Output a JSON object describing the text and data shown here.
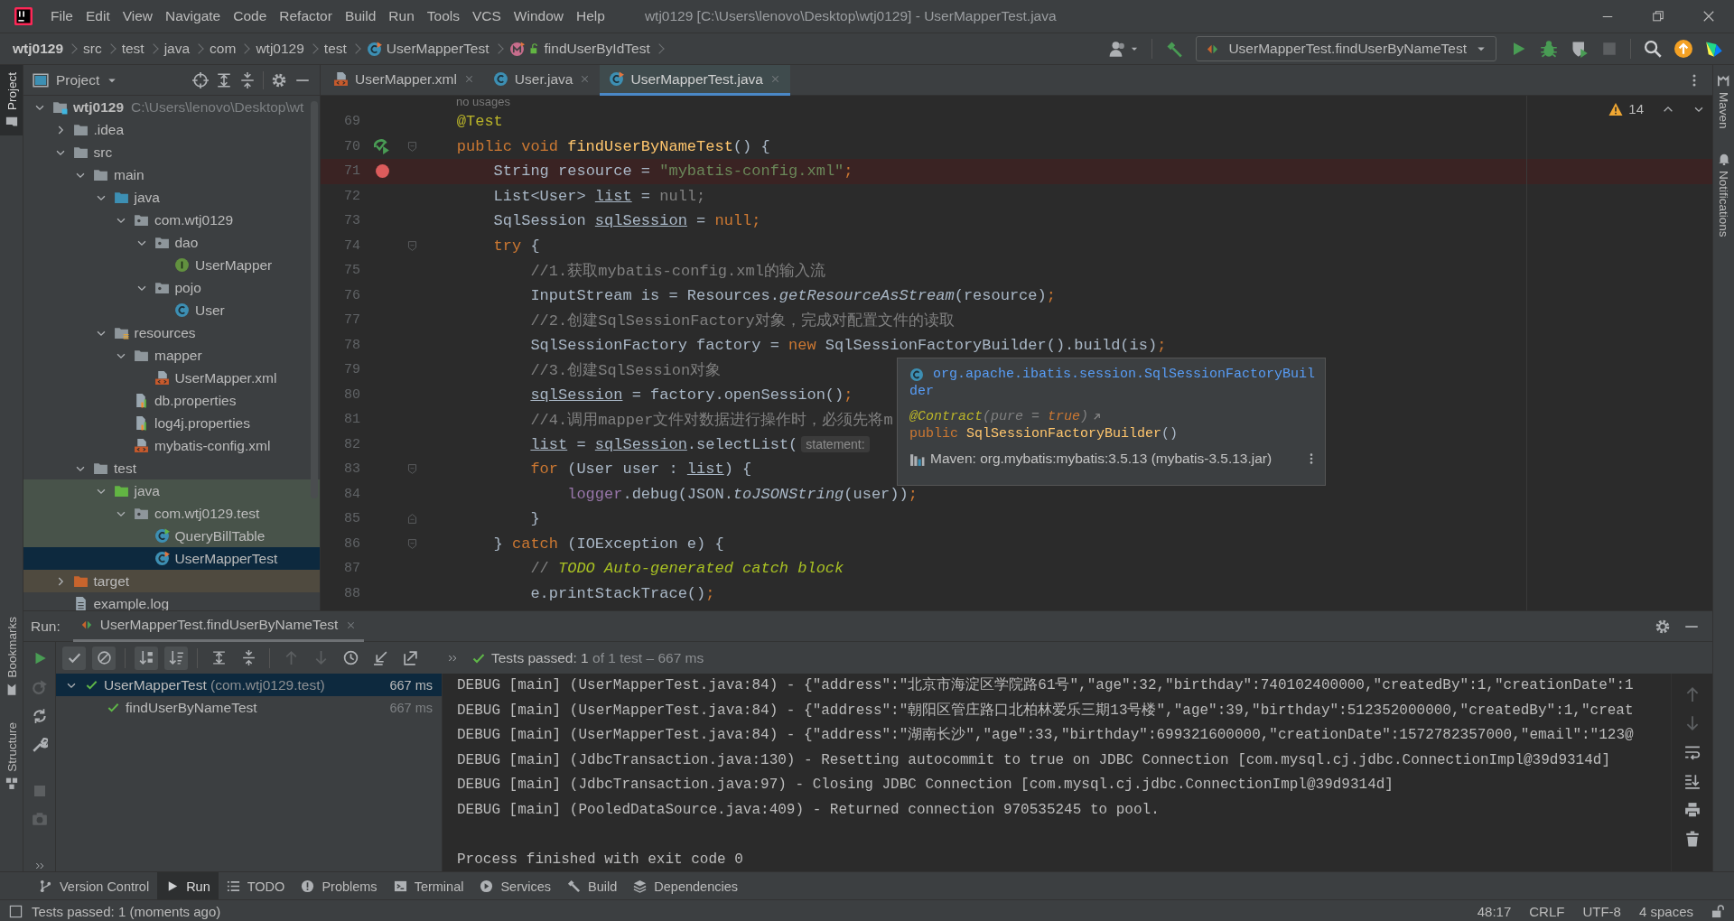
{
  "window": {
    "title": "wtj0129 [C:\\Users\\lenovo\\Desktop\\wtj0129] - UserMapperTest.java"
  },
  "menu": [
    "File",
    "Edit",
    "View",
    "Navigate",
    "Code",
    "Refactor",
    "Build",
    "Run",
    "Tools",
    "VCS",
    "Window",
    "Help"
  ],
  "breadcrumbs": [
    {
      "label": "wtj0129",
      "kind": "project"
    },
    {
      "label": "src",
      "kind": "dir"
    },
    {
      "label": "test",
      "kind": "dir"
    },
    {
      "label": "java",
      "kind": "dir"
    },
    {
      "label": "com",
      "kind": "dir"
    },
    {
      "label": "wtj0129",
      "kind": "dir"
    },
    {
      "label": "test",
      "kind": "dir"
    },
    {
      "label": "UserMapperTest",
      "kind": "class"
    },
    {
      "label": "findUserByIdTest",
      "kind": "method"
    }
  ],
  "run_config": {
    "label": "UserMapperTest.findUserByNameTest"
  },
  "left_strip": [
    {
      "label": "Project",
      "selected": true,
      "kind": "project"
    },
    {
      "label": "Bookmarks",
      "selected": false,
      "kind": "bookmarks"
    },
    {
      "label": "Structure",
      "selected": false,
      "kind": "structure"
    }
  ],
  "right_strip": [
    {
      "label": "Maven",
      "kind": "maven"
    },
    {
      "label": "Notifications",
      "kind": "notifications"
    }
  ],
  "project": {
    "title": "Project",
    "tree": [
      {
        "label": "wtj0129",
        "path": "C:\\Users\\lenovo\\Desktop\\wt",
        "kind": "module",
        "expanded": true,
        "selected": false,
        "children": [
          {
            "label": ".idea",
            "kind": "folder",
            "expanded": false,
            "selected": false
          },
          {
            "label": "src",
            "kind": "folder",
            "expanded": true,
            "selected": false,
            "children": [
              {
                "label": "main",
                "kind": "folder",
                "expanded": true,
                "selected": false,
                "children": [
                  {
                    "label": "java",
                    "kind": "src_folder",
                    "expanded": true,
                    "selected": false,
                    "children": [
                      {
                        "label": "com.wtj0129",
                        "kind": "package",
                        "expanded": true,
                        "selected": false,
                        "children": [
                          {
                            "label": "dao",
                            "kind": "package",
                            "expanded": true,
                            "selected": false,
                            "children": [
                              {
                                "label": "UserMapper",
                                "kind": "interface",
                                "selected": false
                              }
                            ]
                          },
                          {
                            "label": "pojo",
                            "kind": "package",
                            "expanded": true,
                            "selected": false,
                            "children": [
                              {
                                "label": "User",
                                "kind": "class",
                                "selected": false
                              }
                            ]
                          }
                        ]
                      }
                    ]
                  },
                  {
                    "label": "resources",
                    "kind": "resources",
                    "expanded": true,
                    "selected": false,
                    "children": [
                      {
                        "label": "mapper",
                        "kind": "folder",
                        "expanded": true,
                        "selected": false,
                        "children": [
                          {
                            "label": "UserMapper.xml",
                            "kind": "xml",
                            "selected": false
                          }
                        ]
                      },
                      {
                        "label": "db.properties",
                        "kind": "properties",
                        "selected": false
                      },
                      {
                        "label": "log4j.properties",
                        "kind": "properties",
                        "selected": false
                      },
                      {
                        "label": "mybatis-config.xml",
                        "kind": "xml",
                        "selected": false
                      }
                    ]
                  }
                ]
              },
              {
                "label": "test",
                "kind": "folder",
                "expanded": true,
                "selected": false,
                "children": [
                  {
                    "label": "java",
                    "kind": "test_folder",
                    "expanded": true,
                    "selected": false,
                    "children": [
                      {
                        "label": "com.wtj0129.test",
                        "kind": "test_package",
                        "expanded": true,
                        "selected": false,
                        "children": [
                          {
                            "label": "QueryBillTable",
                            "kind": "test_class",
                            "selected": false
                          },
                          {
                            "label": "UserMapperTest",
                            "kind": "test_class_modified",
                            "selected": true
                          }
                        ]
                      }
                    ]
                  }
                ]
              }
            ]
          },
          {
            "label": "target",
            "kind": "excluded_folder",
            "expanded": false,
            "selected": false
          },
          {
            "label": "example.log",
            "kind": "log",
            "selected": false
          }
        ]
      }
    ]
  },
  "editor": {
    "tabs": [
      {
        "label": "UserMapper.xml",
        "kind": "xml",
        "selected": false
      },
      {
        "label": "User.java",
        "kind": "class",
        "selected": false
      },
      {
        "label": "UserMapperTest.java",
        "kind": "test_class_modified",
        "selected": true
      }
    ],
    "usage_hint": "no usages",
    "warnings": "14",
    "lines": [
      {
        "number": "69",
        "breakpoint": false,
        "run_marker": false,
        "fold_start": false,
        "fold_end": false,
        "tokens": [
          {
            "text": "@Test",
            "kind": "annotation"
          }
        ]
      },
      {
        "number": "70",
        "breakpoint": false,
        "run_marker": true,
        "fold_start": true,
        "fold_end": false,
        "tokens": [
          {
            "text": "public void ",
            "kind": "keyword"
          },
          {
            "text": "findUserByNameTest",
            "kind": "method"
          },
          {
            "text": "() {",
            "kind": "plain"
          }
        ],
        "children": [
          {
            "number": "71",
            "breakpoint": true,
            "run_marker": false,
            "fold_start": false,
            "fold_end": false,
            "tokens": [
              {
                "text": "String resource = ",
                "kind": "plain"
              },
              {
                "text": "\"mybatis-config.xml\"",
                "kind": "string"
              },
              {
                "text": ";",
                "kind": "keyword"
              }
            ]
          },
          {
            "number": "72",
            "breakpoint": false,
            "run_marker": false,
            "fold_start": false,
            "fold_end": false,
            "tokens": [
              {
                "text": "List<User> ",
                "kind": "plain"
              },
              {
                "text": "list",
                "kind": "variable"
              },
              {
                "text": " = ",
                "kind": "plain"
              },
              {
                "text": "null;",
                "kind": "muted"
              }
            ]
          },
          {
            "number": "73",
            "breakpoint": false,
            "run_marker": false,
            "fold_start": false,
            "fold_end": false,
            "tokens": [
              {
                "text": "SqlSession ",
                "kind": "plain"
              },
              {
                "text": "sqlSession",
                "kind": "variable"
              },
              {
                "text": " = ",
                "kind": "plain"
              },
              {
                "text": "null;",
                "kind": "keyword"
              }
            ]
          },
          {
            "number": "74",
            "breakpoint": false,
            "run_marker": false,
            "fold_start": true,
            "fold_end": false,
            "tokens": [
              {
                "text": "try",
                "kind": "keyword"
              },
              {
                "text": " {",
                "kind": "plain"
              }
            ],
            "children": [
              {
                "number": "75",
                "breakpoint": false,
                "run_marker": false,
                "fold_start": false,
                "fold_end": false,
                "tokens": [
                  {
                    "text": "//1.获取mybatis-config.xml的输入流",
                    "kind": "comment"
                  }
                ]
              },
              {
                "number": "76",
                "breakpoint": false,
                "run_marker": false,
                "fold_start": false,
                "fold_end": false,
                "tokens": [
                  {
                    "text": "InputStream is = Resources.",
                    "kind": "plain"
                  },
                  {
                    "text": "getResourceAsStream",
                    "kind": "static"
                  },
                  {
                    "text": "(resource)",
                    "kind": "plain"
                  },
                  {
                    "text": ";",
                    "kind": "keyword"
                  }
                ]
              },
              {
                "number": "77",
                "breakpoint": false,
                "run_marker": false,
                "fold_start": false,
                "fold_end": false,
                "tokens": [
                  {
                    "text": "//2.创建SqlSessionFactory对象，完成对配置文件的读取",
                    "kind": "comment"
                  }
                ]
              },
              {
                "number": "78",
                "breakpoint": false,
                "run_marker": false,
                "fold_start": false,
                "fold_end": false,
                "tokens": [
                  {
                    "text": "SqlSessionFactory factory = ",
                    "kind": "plain"
                  },
                  {
                    "text": "new",
                    "kind": "keyword"
                  },
                  {
                    "text": " SqlSessionFactoryBuilder().build(is)",
                    "kind": "plain"
                  },
                  {
                    "text": ";",
                    "kind": "keyword"
                  }
                ]
              },
              {
                "number": "79",
                "breakpoint": false,
                "run_marker": false,
                "fold_start": false,
                "fold_end": false,
                "tokens": [
                  {
                    "text": "//3.创建SqlSession对象",
                    "kind": "comment"
                  }
                ]
              },
              {
                "number": "80",
                "breakpoint": false,
                "run_marker": false,
                "fold_start": false,
                "fold_end": false,
                "tokens": [
                  {
                    "text": "sqlSession",
                    "kind": "variable"
                  },
                  {
                    "text": " = factory.openSession()",
                    "kind": "plain"
                  },
                  {
                    "text": ";",
                    "kind": "keyword"
                  }
                ]
              },
              {
                "number": "81",
                "breakpoint": false,
                "run_marker": false,
                "fold_start": false,
                "fold_end": false,
                "tokens": [
                  {
                    "text": "//4.调用mapper文件对数据进行操作时，必须先将m",
                    "kind": "comment"
                  }
                ]
              },
              {
                "number": "82",
                "breakpoint": false,
                "run_marker": false,
                "fold_start": false,
                "fold_end": false,
                "tokens": [
                  {
                    "text": "list",
                    "kind": "variable"
                  },
                  {
                    "text": " = ",
                    "kind": "plain"
                  },
                  {
                    "text": "sqlSession",
                    "kind": "variable"
                  },
                  {
                    "text": ".selectList(",
                    "kind": "plain"
                  },
                  {
                    "text": "statement:",
                    "kind": "hint"
                  }
                ]
              },
              {
                "number": "83",
                "breakpoint": false,
                "run_marker": false,
                "fold_start": true,
                "fold_end": false,
                "tokens": [
                  {
                    "text": "for",
                    "kind": "keyword"
                  },
                  {
                    "text": " (User user : ",
                    "kind": "plain"
                  },
                  {
                    "text": "list",
                    "kind": "variable"
                  },
                  {
                    "text": ") {",
                    "kind": "plain"
                  }
                ],
                "children": [
                  {
                    "number": "84",
                    "breakpoint": false,
                    "run_marker": false,
                    "fold_start": false,
                    "fold_end": false,
                    "tokens": [
                      {
                        "text": "logger",
                        "kind": "field"
                      },
                      {
                        "text": ".debug(JSON.",
                        "kind": "plain"
                      },
                      {
                        "text": "toJSONString",
                        "kind": "static"
                      },
                      {
                        "text": "(user))",
                        "kind": "plain"
                      },
                      {
                        "text": ";",
                        "kind": "keyword"
                      }
                    ]
                  }
                ]
              },
              {
                "number": "85",
                "breakpoint": false,
                "run_marker": false,
                "fold_start": false,
                "fold_end": true,
                "tokens": [
                  {
                    "text": "}",
                    "kind": "plain"
                  }
                ]
              }
            ]
          },
          {
            "number": "86",
            "breakpoint": false,
            "run_marker": false,
            "fold_start": true,
            "fold_end": false,
            "tokens": [
              {
                "text": "} ",
                "kind": "plain"
              },
              {
                "text": "catch",
                "kind": "keyword"
              },
              {
                "text": " (IOException e) {",
                "kind": "plain"
              }
            ],
            "children": [
              {
                "number": "87",
                "breakpoint": false,
                "run_marker": false,
                "fold_start": false,
                "fold_end": false,
                "tokens": [
                  {
                    "text": "// ",
                    "kind": "comment"
                  },
                  {
                    "text": "TODO Auto-generated catch block",
                    "kind": "todo"
                  }
                ]
              },
              {
                "number": "88",
                "breakpoint": false,
                "run_marker": false,
                "fold_start": false,
                "fold_end": false,
                "tokens": [
                  {
                    "text": "e.printStackTrace()",
                    "kind": "plain"
                  },
                  {
                    "text": ";",
                    "kind": "keyword"
                  }
                ]
              }
            ]
          }
        ]
      }
    ],
    "popup": {
      "qualified_name": "org.apache.ibatis.session.SqlSessionFactoryBuilder",
      "annotation": [
        {
          "text": "@Contract",
          "kind": "annotation"
        },
        {
          "text": "(pure = ",
          "kind": "muted"
        },
        {
          "text": "true",
          "kind": "keyword"
        },
        {
          "text": ")",
          "kind": "muted"
        }
      ],
      "signature": [
        {
          "text": "public ",
          "kind": "keyword"
        },
        {
          "text": "SqlSessionFactoryBuilder",
          "kind": "method"
        },
        {
          "text": "()",
          "kind": "plain"
        }
      ],
      "source": "Maven: org.mybatis:mybatis:3.5.13 (mybatis-3.5.13.jar)"
    }
  },
  "run": {
    "label": "Run:",
    "tabs": [
      {
        "label": "UserMapperTest.findUserByNameTest",
        "selected": true
      }
    ],
    "toggles": [
      {
        "kind": "show_passed",
        "on": true
      },
      {
        "kind": "show_ignored",
        "on": true
      },
      {
        "kind": "sort_alpha",
        "on": true
      },
      {
        "kind": "sort_duration",
        "on": true
      }
    ],
    "summary": {
      "passed": "Tests passed: 1",
      "detail": "of 1 test – 667 ms"
    },
    "tests": [
      {
        "label": "UserMapperTest",
        "detail": "(com.wtj0129.test)",
        "time": "667 ms",
        "passed": true,
        "selected": true,
        "expanded": true,
        "children": [
          {
            "label": "findUserByNameTest",
            "time": "667 ms",
            "passed": true,
            "selected": false
          }
        ]
      }
    ],
    "console": [
      {
        "kind": "log",
        "text": "DEBUG [main] (UserMapperTest.java:84) - {\"address\":\"北京市海淀区学院路61号\",\"age\":32,\"birthday\":740102400000,\"createdBy\":1,\"creationDate\":1"
      },
      {
        "kind": "log",
        "text": "DEBUG [main] (UserMapperTest.java:84) - {\"address\":\"朝阳区管庄路口北柏林爱乐三期13号楼\",\"age\":39,\"birthday\":512352000000,\"createdBy\":1,\"creat"
      },
      {
        "kind": "log",
        "text": "DEBUG [main] (UserMapperTest.java:84) - {\"address\":\"湖南长沙\",\"age\":33,\"birthday\":699321600000,\"creationDate\":1572782357000,\"email\":\"123@"
      },
      {
        "kind": "log",
        "text": "DEBUG [main] (JdbcTransaction.java:130) - Resetting autocommit to true on JDBC Connection [com.mysql.cj.jdbc.ConnectionImpl@39d9314d]"
      },
      {
        "kind": "log",
        "text": "DEBUG [main] (JdbcTransaction.java:97) - Closing JDBC Connection [com.mysql.cj.jdbc.ConnectionImpl@39d9314d]"
      },
      {
        "kind": "log",
        "text": "DEBUG [main] (PooledDataSource.java:409) - Returned connection 970535245 to pool."
      },
      {
        "kind": "exit",
        "text": "Process finished with exit code 0"
      }
    ]
  },
  "tool_windows": [
    {
      "label": "Version Control",
      "kind": "vcs",
      "selected": false
    },
    {
      "label": "Run",
      "kind": "run",
      "selected": true
    },
    {
      "label": "TODO",
      "kind": "todo",
      "selected": false
    },
    {
      "label": "Problems",
      "kind": "problems",
      "selected": false
    },
    {
      "label": "Terminal",
      "kind": "terminal",
      "selected": false
    },
    {
      "label": "Services",
      "kind": "services",
      "selected": false
    },
    {
      "label": "Build",
      "kind": "build",
      "selected": false
    },
    {
      "label": "Dependencies",
      "kind": "dependencies",
      "selected": false
    }
  ],
  "status_bar": {
    "message": "Tests passed: 1 (moments ago)",
    "position": "48:17",
    "line_separator": "CRLF",
    "encoding": "UTF-8",
    "indent": "4 spaces"
  }
}
